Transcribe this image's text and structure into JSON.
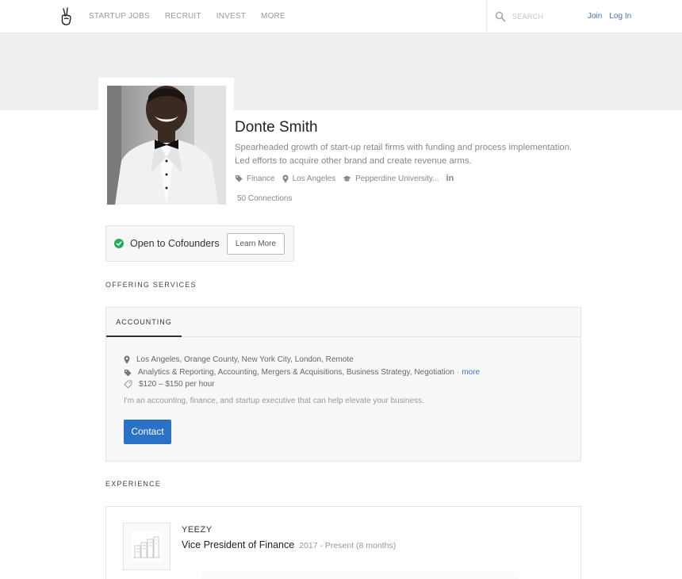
{
  "nav": {
    "links": [
      "STARTUP JOBS",
      "RECRUIT",
      "INVEST",
      "MORE"
    ],
    "search_placeholder": "SEARCH",
    "join": "Join",
    "login": "Log In"
  },
  "profile": {
    "name": "Donte Smith",
    "bio": "Spearheaded growth of start-up retail firms with funding and process implementation. Led efforts to acquire other brand and create revenue arms.",
    "tags": {
      "market": "Finance",
      "location": "Los Angeles",
      "school": "Pepperdine University..."
    },
    "linkedin_label": "in",
    "connections": "50 Connections"
  },
  "cofounder": {
    "text": "Open to Cofounders",
    "button": "Learn More"
  },
  "services": {
    "section_title": "OFFERING SERVICES",
    "tab": "ACCOUNTING",
    "locations": "Los Angeles, Orange County, New York City, London, Remote",
    "skills": "Analytics & Reporting, Accounting, Mergers & Acquisitions, Business Strategy, Negotiation",
    "skills_separator": "·",
    "more": "more",
    "rate": "$120 – $150 per hour",
    "description": "I'm an accounting, finance, and startup executive that can help elevate your business.",
    "contact": "Contact"
  },
  "experience": {
    "section_title": "EXPERIENCE",
    "company": "YEEZY",
    "title": "Vice President of Finance",
    "dates": "2017 - Present (8 months)"
  },
  "colors": {
    "accent_blue": "#2b72c6",
    "link_blue": "#3a78c8",
    "check_green": "#1fae5b",
    "cover_gray": "#efeff0"
  },
  "icons": [
    "victory-hand-logo-icon",
    "search-icon",
    "tag-icon",
    "map-pin-icon",
    "graduation-cap-icon",
    "linkedin-icon",
    "check-circle-icon",
    "money-tag-icon",
    "building-icon"
  ]
}
